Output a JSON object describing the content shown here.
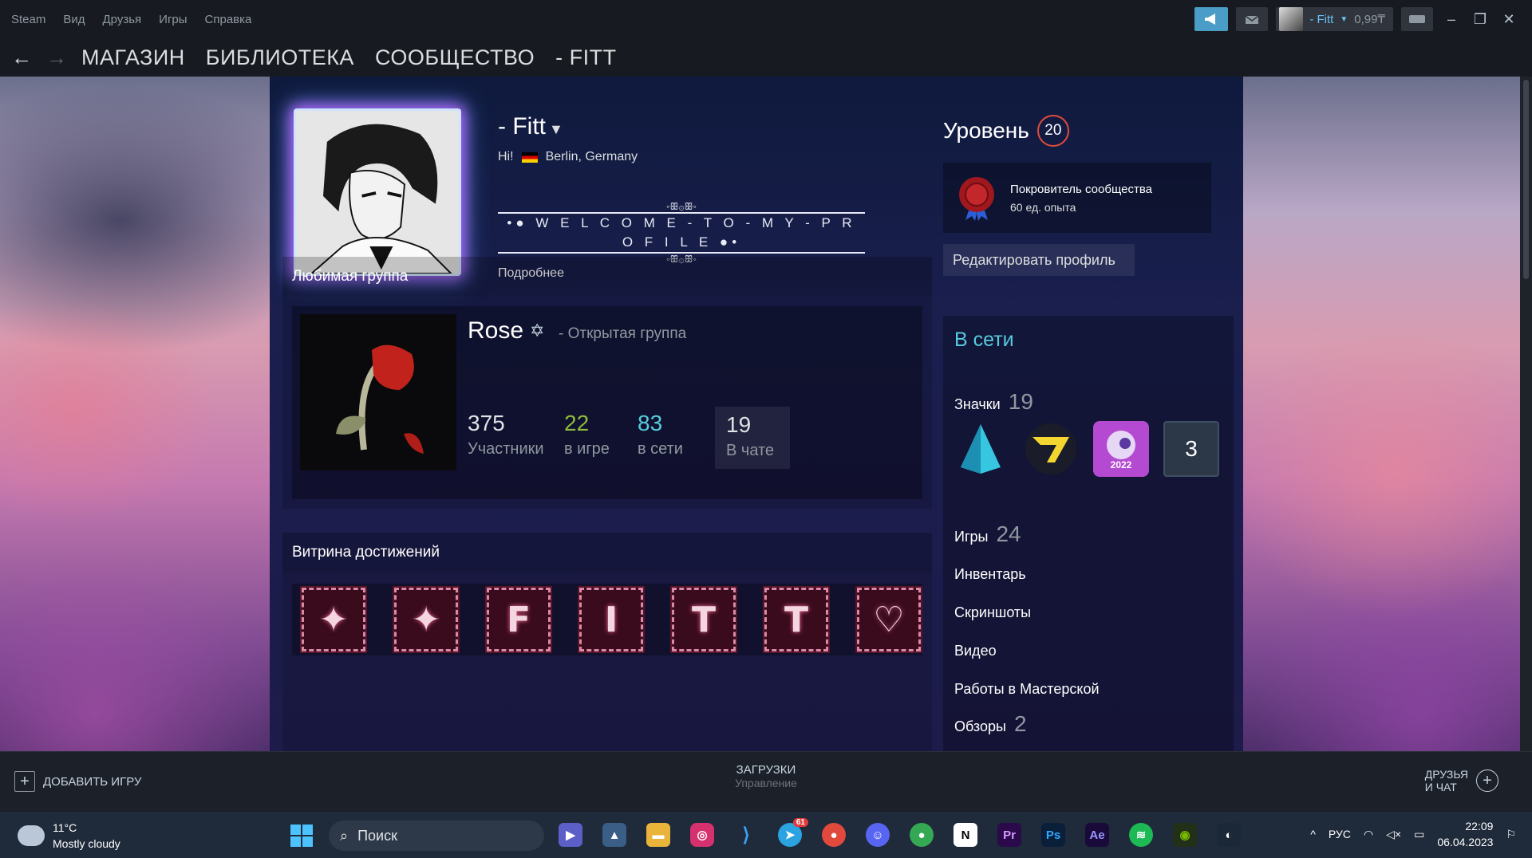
{
  "menubar": {
    "items": [
      "Steam",
      "Вид",
      "Друзья",
      "Игры",
      "Справка"
    ]
  },
  "account": {
    "name": "- Fitt",
    "balance": "0,99₸"
  },
  "nav": {
    "items": [
      "МАГАЗИН",
      "БИБЛИОТЕКА",
      "СООБЩЕСТВО",
      "- FITT"
    ]
  },
  "profile": {
    "name": "- Fitt",
    "greeting": "Hi!",
    "location": "Berlin, Germany",
    "welcome": "•● W E L C O M E - T O - M Y - P R O F I L E ●•",
    "ornament": "◦ꕥ۞ꕥ◦",
    "more": "Подробнее"
  },
  "level": {
    "label": "Уровень",
    "value": "20"
  },
  "badge_showcase": {
    "title": "Покровитель сообщества",
    "xp": "60 ед. опыта"
  },
  "edit_profile": "Редактировать профиль",
  "group_panel": {
    "title": "Любимая группа",
    "name": "Rose",
    "type": "- Открытая группа",
    "stats": [
      {
        "n": "375",
        "l": "Участники",
        "color": "#dfe3e6"
      },
      {
        "n": "22",
        "l": "в игре",
        "color": "#90ba3c"
      },
      {
        "n": "83",
        "l": "в сети",
        "color": "#57cbde"
      },
      {
        "n": "19",
        "l": "В чате",
        "color": "#dfe3e6"
      }
    ]
  },
  "achievements_panel": {
    "title": "Витрина достижений",
    "items": [
      "✦",
      "✦",
      "F",
      "I",
      "T",
      "T",
      "♡"
    ]
  },
  "sidebar": {
    "status": "В сети",
    "badges_label": "Значки",
    "badges_count": "19",
    "badge_card_num": "3",
    "badge_year": "2022",
    "games_label": "Игры",
    "games_count": "24",
    "inventory": "Инвентарь",
    "screenshots": "Скриншоты",
    "videos": "Видео",
    "workshop": "Работы в Мастерской",
    "reviews_label": "Обзоры",
    "reviews_count": "2"
  },
  "bottombar": {
    "add_game": "ДОБАВИТЬ ИГРУ",
    "downloads": "ЗАГРУЗКИ",
    "manage": "Управление",
    "friends_line1": "ДРУЗЬЯ",
    "friends_line2": "И ЧАТ"
  },
  "taskbar": {
    "temp": "11°C",
    "weather": "Mostly cloudy",
    "search": "Поиск",
    "lang": "РУС",
    "time": "22:09",
    "date": "06.04.2023",
    "telegram_badge": "61"
  }
}
